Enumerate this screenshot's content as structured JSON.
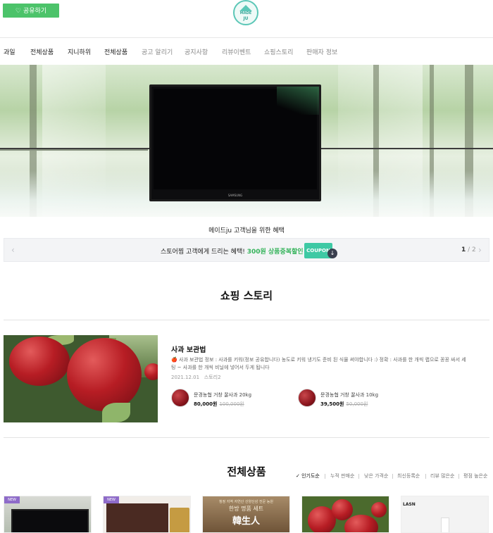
{
  "header": {
    "share_label": "공유하기",
    "share_icon": "heart-hands-icon",
    "logo_line1": "MADE",
    "logo_line2": "JU"
  },
  "nav": {
    "items": [
      "과일",
      "전체상품",
      "지니하위",
      "전체상품",
      "공고 알리기",
      "공지사항",
      "리뷰이벤트",
      "쇼핑스토리",
      "판매자 정보"
    ]
  },
  "hero": {
    "monitor_brand": "SAMSUNG"
  },
  "benefit": {
    "title": "메이드ju 고객님을 위한 혜택"
  },
  "coupon": {
    "message": "스토어찜 고객에게 드리는 혜택! ",
    "highlight": "300원 상품중복할인",
    "ticket_label": "COUPON",
    "page_current": "1",
    "page_total": "/ 2",
    "prev_icon": "chevron-left-icon",
    "next_icon": "chevron-right-icon",
    "download_icon": "download-arrow-icon"
  },
  "story": {
    "section_title": "쇼핑 스토리",
    "title": "사과 보관법",
    "description": "🍎 사과 보관법 정보 : 사과를 키워(정보 공유합니다) 농도로 키워 냉기도 준비 된 식물 써야합니다 :) 정확 : 사과를 한 개씩 랩으로 꽁꽁 싸서 세팅 ~ 사과를 한 개씩 비닐에 넣어서 두게 됩니다",
    "date": "2021.12.01",
    "author": "스토리2",
    "products": [
      {
        "name": "문경농협 거창 꿀사과 20kg",
        "price": "80,000원",
        "original": "100,000원"
      },
      {
        "name": "문경농협 거창 꿀사과 10kg",
        "price": "39,500원",
        "original": "50,000원"
      }
    ]
  },
  "all_products": {
    "section_title": "전체상품",
    "sort_options": [
      {
        "label": "✓ 인기도순",
        "active": true
      },
      {
        "label": "누적 판매순",
        "active": false
      },
      {
        "label": "낮은 가격순",
        "active": false
      },
      {
        "label": "최신등록순",
        "active": false
      },
      {
        "label": "리뷰 많은순",
        "active": false
      },
      {
        "label": "평점 높은순",
        "active": false
      }
    ],
    "cards": [
      {
        "badge": "NEW"
      },
      {
        "badge": "NEW"
      },
      {
        "line1": "청정 지역 자연산 산양산삼 전문 농원",
        "line2": "한방 명품 세트",
        "line3": "韓生人"
      },
      {},
      {
        "label": "LASN"
      }
    ]
  }
}
